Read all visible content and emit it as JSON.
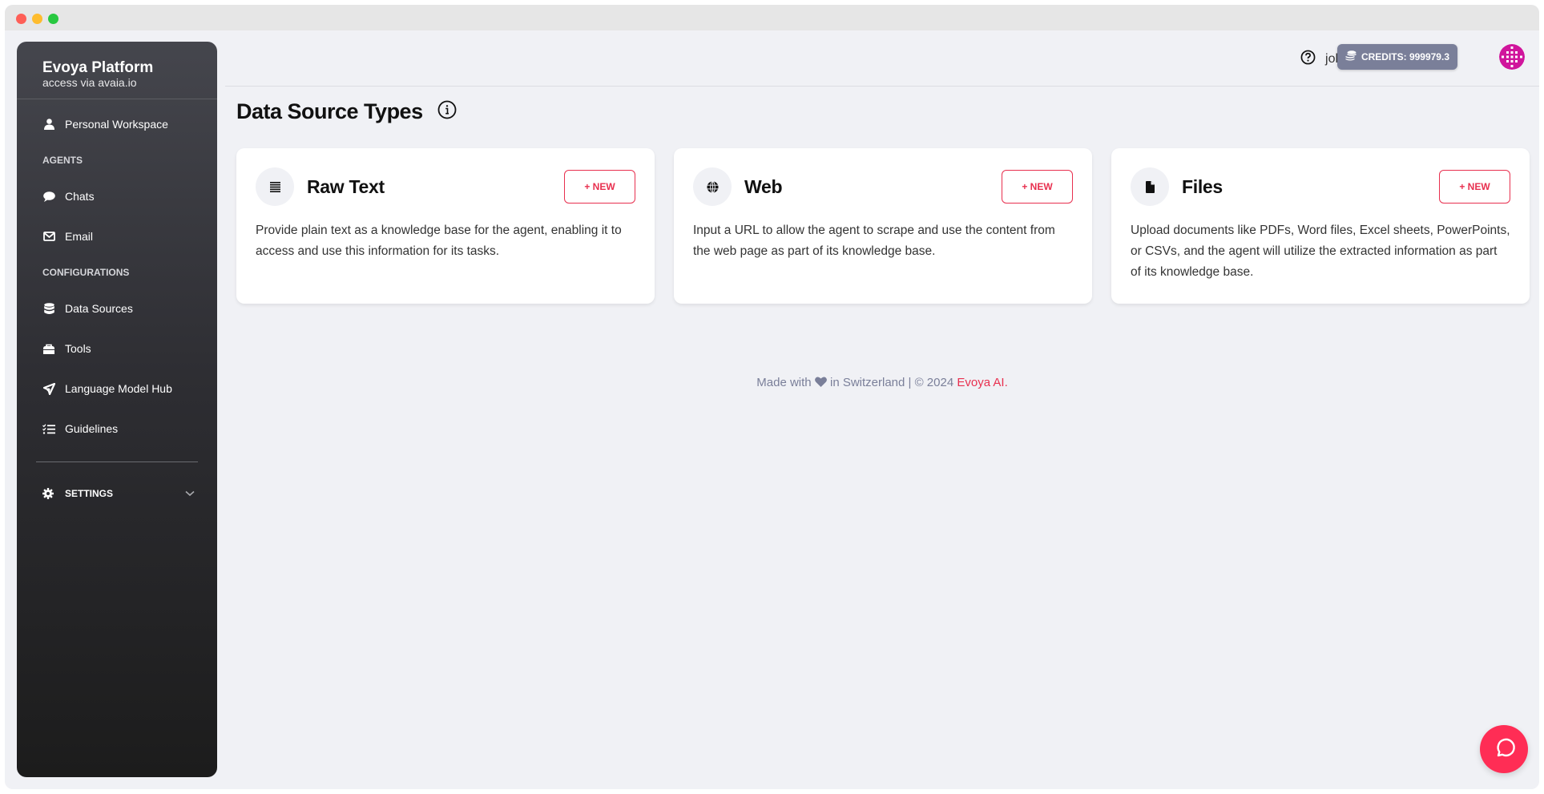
{
  "sidebar": {
    "brand_title": "Evoya Platform",
    "brand_subtitle": "access via avaia.io",
    "personal_workspace": "Personal Workspace",
    "sections": {
      "agents": "AGENTS",
      "configurations": "CONFIGURATIONS"
    },
    "items": {
      "chats": "Chats",
      "email": "Email",
      "data_sources": "Data Sources",
      "tools": "Tools",
      "language_model_hub": "Language Model Hub",
      "guidelines": "Guidelines"
    },
    "settings": "SETTINGS"
  },
  "topbar": {
    "username": "johndoe",
    "credits": "CREDITS: 999979.3"
  },
  "page": {
    "title": "Data Source Types"
  },
  "cards": [
    {
      "title": "Raw Text",
      "icon": "lines-icon",
      "button": "+ NEW",
      "description": "Provide plain text as a knowledge base for the agent, enabling it to access and use this information for its tasks."
    },
    {
      "title": "Web",
      "icon": "globe-icon",
      "button": "+ NEW",
      "description": "Input a URL to allow the agent to scrape and use the content from the web page as part of its knowledge base."
    },
    {
      "title": "Files",
      "icon": "file-icon",
      "button": "+ NEW",
      "description": "Upload documents like PDFs, Word files, Excel sheets, PowerPoints, or CSVs, and the agent will utilize the extracted information as part of its knowledge base."
    }
  ],
  "footer": {
    "prefix": "Made with",
    "middle": "in Switzerland | © 2024",
    "brand": "Evoya AI",
    "suffix": "."
  },
  "colors": {
    "accent": "#e8304f",
    "fab": "#ff2d55",
    "credits_bg": "#7a7f99",
    "background": "#f0f1f5"
  }
}
